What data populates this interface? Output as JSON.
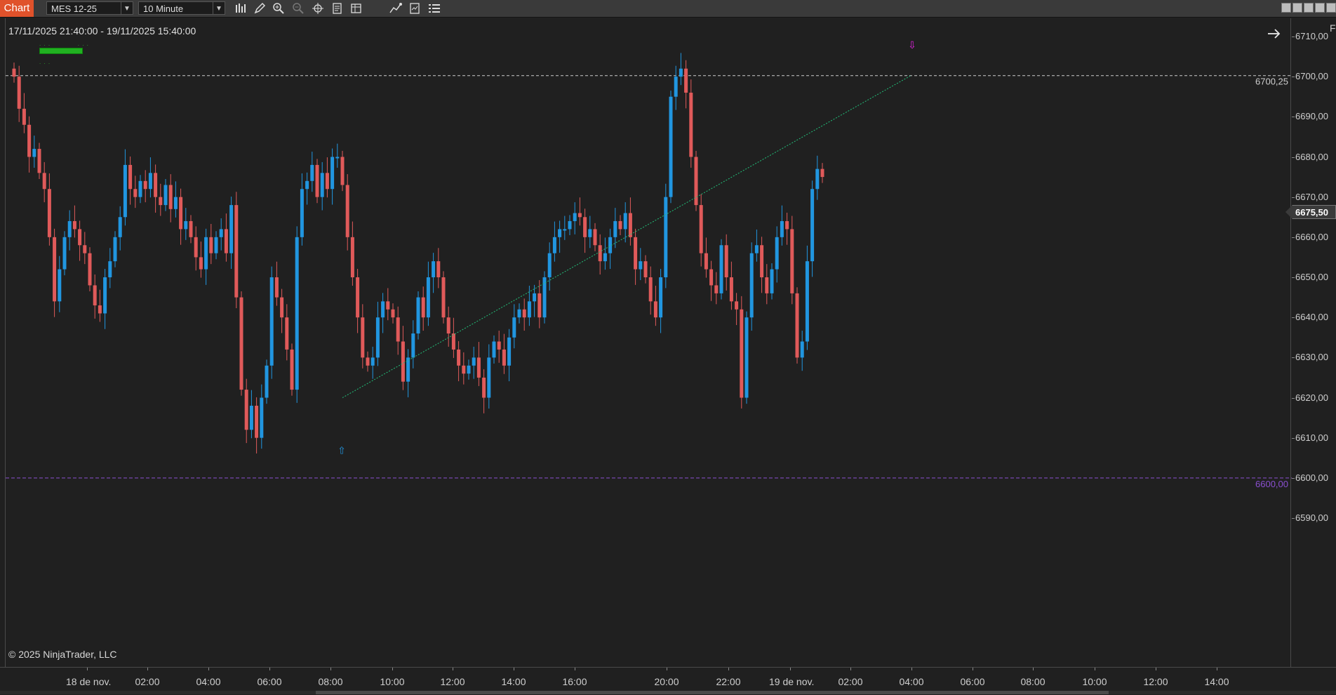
{
  "toolbar": {
    "app_tab": "Chart",
    "instrument": "MES 12-25",
    "interval": "10 Minute",
    "icons": [
      "bar-type-icon",
      "draw-pencil-icon",
      "zoom-in-icon",
      "zoom-out-icon",
      "crosshair-icon",
      "properties-icon",
      "templates-icon",
      "strategies-icon",
      "data-box-icon",
      "chart-trader-icon"
    ]
  },
  "chart": {
    "range_label": "17/11/2025 21:40:00 - 19/11/2025 15:40:00",
    "copyright": "© 2025 NinjaTrader, LLC",
    "corner_label": "F",
    "colors": {
      "background": "#202020",
      "up_candle": "#2196e0",
      "down_candle": "#e05a5a",
      "trend_line": "#22c07a",
      "level_white": "#cccccc",
      "level_purple": "#8a4fd0",
      "signal_buy": "#2196e0",
      "signal_sell": "#e020e0"
    }
  },
  "price_axis": {
    "ticks": [
      "6710,00",
      "6700,00",
      "6690,00",
      "6680,00",
      "6670,00",
      "6660,00",
      "6650,00",
      "6640,00",
      "6630,00",
      "6620,00",
      "6610,00",
      "6600,00",
      "6590,00"
    ],
    "current_price": "6675,50",
    "level_upper": "6700,25",
    "level_lower": "6600,00"
  },
  "time_axis": {
    "labels": [
      "18 de nov.",
      "02:00",
      "04:00",
      "06:00",
      "08:00",
      "10:00",
      "12:00",
      "14:00",
      "16:00",
      "20:00",
      "22:00",
      "19 de nov.",
      "02:00",
      "04:00",
      "06:00",
      "08:00",
      "10:00",
      "12:00",
      "14:00"
    ]
  },
  "chart_data": {
    "type": "candlestick",
    "instrument": "MES 12-25",
    "interval": "10 Minute",
    "ylim": [
      6586,
      6713
    ],
    "horizontal_lines": [
      6700.25,
      6600.0
    ],
    "trend_line": {
      "from": 6620.0,
      "to": 6700.25
    },
    "closes": [
      6700,
      6692,
      6688,
      6680,
      6682,
      6676,
      6672,
      6660,
      6644,
      6652,
      6660,
      6664,
      6662,
      6658,
      6656,
      6648,
      6643,
      6641,
      6650,
      6654,
      6660,
      6665,
      6678,
      6672,
      6670,
      6674,
      6672,
      6676,
      6670,
      6668,
      6673,
      6667,
      6670,
      6662,
      6664,
      6660,
      6655,
      6652,
      6660,
      6656,
      6660,
      6662,
      6656,
      6668,
      6645,
      6622,
      6612,
      6618,
      6610,
      6620,
      6628,
      6650,
      6645,
      6640,
      6632,
      6622,
      6660,
      6672,
      6674,
      6678,
      6670,
      6676,
      6672,
      6680,
      6680,
      6673,
      6660,
      6650,
      6640,
      6630,
      6628,
      6630,
      6640,
      6644,
      6642,
      6640,
      6634,
      6624,
      6630,
      6636,
      6645,
      6640,
      6650,
      6654,
      6650,
      6640,
      6636,
      6632,
      6628,
      6626,
      6628,
      6630,
      6625,
      6620,
      6630,
      6634,
      6632,
      6628,
      6635,
      6640,
      6642,
      6640,
      6644,
      6646,
      6640,
      6650,
      6656,
      6660,
      6662,
      6662,
      6664,
      6666,
      6665,
      6660,
      6662,
      6658,
      6654,
      6656,
      6660,
      6664,
      6662,
      6666,
      6660,
      6652,
      6654,
      6650,
      6644,
      6640,
      6650,
      6670,
      6695,
      6700,
      6702,
      6696,
      6680,
      6668,
      6656,
      6652,
      6648,
      6646,
      6658,
      6650,
      6644,
      6642,
      6620,
      6640,
      6656,
      6658,
      6650,
      6646,
      6652,
      6660,
      6664,
      6662,
      6646,
      6630,
      6634,
      6654,
      6672,
      6677,
      6675
    ]
  }
}
